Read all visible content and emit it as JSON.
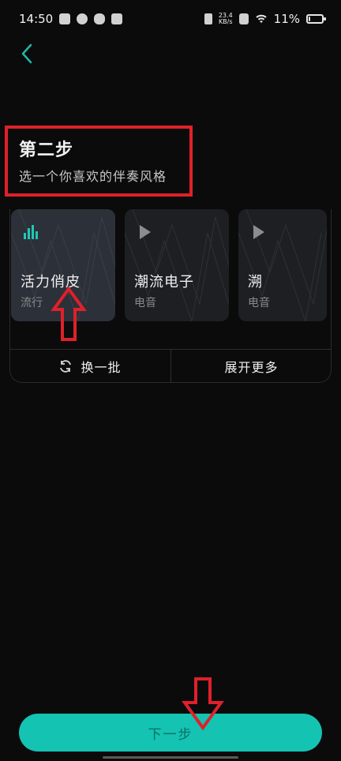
{
  "status_bar": {
    "time": "14:50",
    "network_speed": "23.4\nKB/s",
    "battery_percent": "11%",
    "battery_level": 0.11
  },
  "header": {
    "back_icon": "chevron-left-icon"
  },
  "step": {
    "title": "第二步",
    "subtitle": "选一个你喜欢的伴奏风格"
  },
  "styles": {
    "cards": [
      {
        "name": "活力俏皮",
        "genre": "流行",
        "state": "playing",
        "icon": "equalizer-icon"
      },
      {
        "name": "潮流电子",
        "genre": "电音",
        "state": "paused",
        "icon": "play-icon"
      },
      {
        "name": "溯",
        "genre": "电音",
        "state": "paused",
        "icon": "play-icon"
      }
    ],
    "refresh_label": "换一批",
    "more_label": "展开更多"
  },
  "footer": {
    "next_label": "下一步"
  },
  "colors": {
    "accent": "#14c3b2",
    "annotation": "#e0202a",
    "background": "#0b0b0c"
  }
}
